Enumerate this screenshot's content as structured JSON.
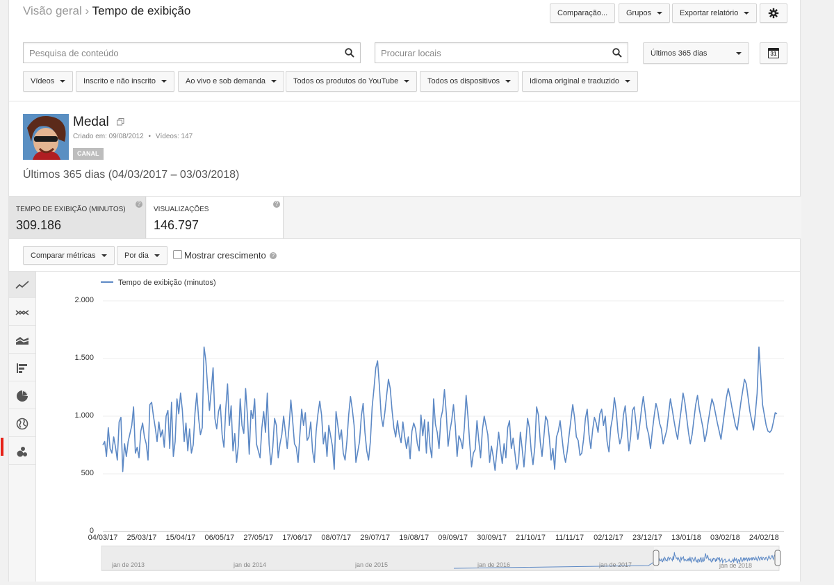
{
  "breadcrumb": {
    "parent": "Visão geral",
    "separator": "›",
    "current": "Tempo de exibição"
  },
  "header_buttons": {
    "compare": "Comparação...",
    "groups": "Grupos",
    "export": "Exportar relatório"
  },
  "search": {
    "content_placeholder": "Pesquisa de conteúdo",
    "locations_placeholder": "Procurar locais"
  },
  "date_range": {
    "label": "Últimos 365 dias",
    "calendar_day": "31"
  },
  "filters": [
    "Vídeos",
    "Inscrito e não inscrito",
    "Ao vivo e sob demanda",
    "Todos os produtos do YouTube",
    "Todos os dispositivos",
    "Idioma original e traduzido"
  ],
  "channel": {
    "name": "Medal",
    "created": "Criado em: 09/08/2012",
    "videos": "Vídeos: 147",
    "badge": "CANAL",
    "period": "Últimos 365 dias (04/03/2017 – 03/03/2018)"
  },
  "metrics": [
    {
      "label": "TEMPO DE EXIBIÇÃO (MINUTOS)",
      "value": "309.186"
    },
    {
      "label": "VISUALIZAÇÕES",
      "value": "146.797"
    }
  ],
  "controls": {
    "compare": "Comparar métricas",
    "per": "Por dia",
    "growth": "Mostrar crescimento"
  },
  "colors": {
    "series": "#5d89c5",
    "accent_red": "#e62117"
  },
  "chart_data": {
    "type": "line",
    "series": [
      {
        "name": "Tempo de exibição (minutos)",
        "values": [
          750,
          780,
          650,
          900,
          720,
          680,
          820,
          730,
          620,
          950,
          990,
          520,
          760,
          650,
          780,
          850,
          920,
          1080,
          680,
          730,
          640,
          870,
          940,
          820,
          760,
          620,
          1100,
          1120,
          1000,
          900,
          780,
          950,
          820,
          880,
          730,
          1000,
          1050,
          720,
          1120,
          650,
          780,
          1150,
          1020,
          1200,
          1050,
          780,
          940,
          700,
          890,
          680,
          750,
          1030,
          1200,
          980,
          840,
          900,
          1600,
          1480,
          1250,
          1050,
          1230,
          1420,
          980,
          890,
          1040,
          1100,
          840,
          730,
          1060,
          1280,
          920,
          1090,
          700,
          850,
          600,
          750,
          1150,
          920,
          850,
          1240,
          1010,
          670,
          1050,
          980,
          1150,
          760,
          700,
          640,
          900,
          1040,
          860,
          1200,
          760,
          580,
          730,
          980,
          920,
          640,
          760,
          840,
          1000,
          860,
          720,
          910,
          1140,
          960,
          760,
          730,
          600,
          840,
          1060,
          920,
          1030,
          790,
          820,
          950,
          700,
          600,
          870,
          1020,
          1130,
          1010,
          760,
          860,
          650,
          920,
          830,
          740,
          540,
          1040,
          920,
          800,
          880,
          680,
          620,
          780,
          1010,
          1170,
          1060,
          920,
          600,
          690,
          780,
          1000,
          1110,
          860,
          700,
          620,
          780,
          1080,
          1240,
          1420,
          1480,
          1260,
          1000,
          910,
          1030,
          1180,
          1320,
          1240,
          1050,
          900,
          820,
          960,
          840,
          770,
          950,
          820,
          720,
          820,
          630,
          870,
          940,
          890,
          760,
          700,
          1010,
          830,
          970,
          680,
          950,
          740,
          640,
          1150,
          930,
          860,
          720,
          980,
          1050,
          1230,
          1030,
          740,
          870,
          960,
          1100,
          920,
          650,
          830,
          790,
          720,
          900,
          1180,
          1000,
          760,
          560,
          680,
          710,
          960,
          790,
          640,
          880,
          1000,
          920,
          840,
          600,
          740,
          650,
          530,
          700,
          860,
          710,
          590,
          760,
          640,
          900,
          960,
          720,
          810,
          680,
          540,
          600,
          860,
          720,
          560,
          760,
          980,
          900,
          700,
          580,
          730,
          1080,
          1010,
          780,
          650,
          820,
          1000,
          960,
          820,
          620,
          720,
          540,
          820,
          870,
          960,
          820,
          680,
          600,
          700,
          840,
          970,
          1100,
          990,
          820,
          790,
          660,
          680,
          800,
          980,
          1060,
          840,
          720,
          880,
          990,
          940,
          860,
          1020,
          1060,
          920,
          1000,
          780,
          690,
          900,
          990,
          1160,
          1050,
          860,
          760,
          820,
          1010,
          1090,
          900,
          700,
          820,
          1050,
          1080,
          930,
          800,
          920,
          1060,
          1170,
          1040,
          900,
          840,
          720,
          870,
          1000,
          1110,
          1050,
          940,
          890,
          760,
          820,
          880,
          1020,
          1150,
          1060,
          960,
          870,
          800,
          940,
          1060,
          1200,
          1120,
          990,
          860,
          760,
          840,
          970,
          1100,
          1180,
          1060,
          980,
          900,
          780,
          850,
          960,
          1060,
          1150,
          1100,
          1020,
          940,
          870,
          800,
          920,
          1040,
          1160,
          1240,
          1170,
          1080,
          1000,
          920,
          880,
          1000,
          1120,
          1220,
          1320,
          1280,
          1160,
          1040,
          960,
          880,
          1020,
          1200,
          1600,
          1350,
          1100,
          1010,
          920,
          870,
          860,
          880,
          950,
          1030,
          1020
        ]
      }
    ],
    "x_ticks": [
      "04/03/17",
      "25/03/17",
      "15/04/17",
      "06/05/17",
      "27/05/17",
      "17/06/17",
      "08/07/17",
      "29/07/17",
      "19/08/17",
      "09/09/17",
      "30/09/17",
      "21/10/17",
      "11/11/17",
      "02/12/17",
      "23/12/17",
      "13/01/18",
      "03/02/18",
      "24/02/18"
    ],
    "y_ticks": [
      "2.000",
      "1.500",
      "1.000",
      "500",
      "0"
    ],
    "ylim": [
      0,
      2000
    ],
    "grid": true,
    "legend": "top-left",
    "navigator_labels": [
      "jan de 2013",
      "jan de 2014",
      "jan de 2015",
      "jan de 2016",
      "jan de 2017",
      "jan de 2018"
    ]
  }
}
